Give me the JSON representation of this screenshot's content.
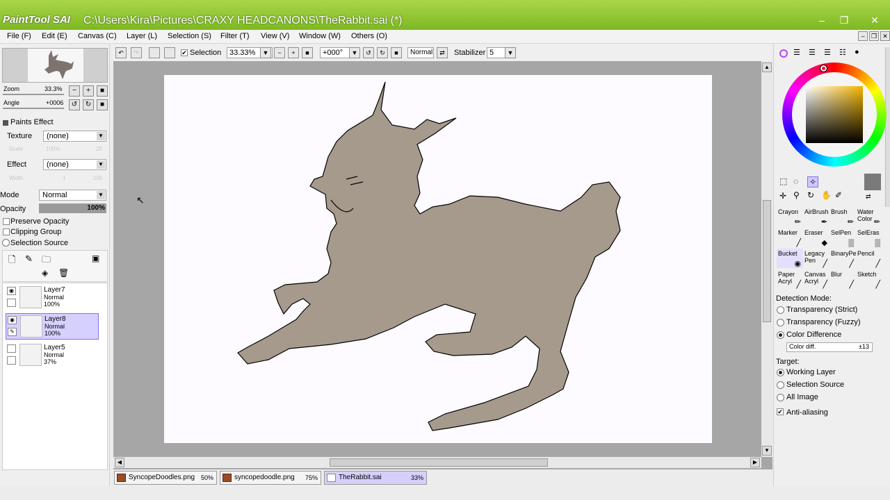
{
  "app": {
    "logo": "PaintTool SAI",
    "title": "C:\\Users\\Kira\\Pictures\\CRAXY HEADCANONS\\TheRabbit.sai (*)",
    "accent": "#8cc63f"
  },
  "menu": [
    "File (F)",
    "Edit (E)",
    "Canvas (C)",
    "Layer (L)",
    "Selection (S)",
    "Filter (T)",
    "View (V)",
    "Window (W)",
    "Others (O)"
  ],
  "navigator": {
    "zoom_label": "Zoom",
    "zoom_value": "33.3%",
    "angle_label": "Angle",
    "angle_value": "+0006"
  },
  "paints_effect": {
    "header": "Paints Effect",
    "texture_label": "Texture",
    "texture_value": "(none)",
    "scale_label": "Scale",
    "scale_value": "100%",
    "scale_num": "20",
    "effect_label": "Effect",
    "effect_value": "(none)",
    "width_label": "Width",
    "width_value": "1",
    "width_num": "100"
  },
  "layer_props": {
    "mode_label": "Mode",
    "mode_value": "Normal",
    "opacity_label": "Opacity",
    "opacity_value": "100%",
    "opacity_fraction": 1.0,
    "preserve_opacity": "Preserve Opacity",
    "clipping_group": "Clipping Group",
    "selection_source": "Selection Source"
  },
  "layers": [
    {
      "name": "Layer7",
      "mode": "Normal",
      "opacity": "100%",
      "selected": false,
      "visible": true
    },
    {
      "name": "Layer8",
      "mode": "Normal",
      "opacity": "100%",
      "selected": true,
      "visible": true
    },
    {
      "name": "Layer5",
      "mode": "Normal",
      "opacity": "37%",
      "selected": false,
      "visible": false
    }
  ],
  "toolbar": {
    "selection_label": "Selection",
    "selection_checked": true,
    "zoom": "33.33%",
    "angle": "+000°",
    "mode": "Normal",
    "stabilizer_label": "Stabilizer",
    "stabilizer_value": "5"
  },
  "files": [
    {
      "name": "SyncopeDoodles.png",
      "zoom": "50%",
      "active": false
    },
    {
      "name": "syncopedoodle.png",
      "zoom": "75%",
      "active": false
    },
    {
      "name": "TheRabbit.sai",
      "zoom": "33%",
      "active": true
    }
  ],
  "tools": [
    {
      "name": "Crayon",
      "icon": "crayon-icon"
    },
    {
      "name": "AirBrush",
      "icon": "airbrush-icon"
    },
    {
      "name": "Brush",
      "icon": "brush-icon"
    },
    {
      "name": "Water Color",
      "icon": "watercolor-icon"
    },
    {
      "name": "Marker",
      "icon": "marker-icon"
    },
    {
      "name": "Eraser",
      "icon": "eraser-icon"
    },
    {
      "name": "SelPen",
      "icon": "selpen-icon"
    },
    {
      "name": "SelEras",
      "icon": "seleras-icon"
    },
    {
      "name": "Bucket",
      "icon": "bucket-icon"
    },
    {
      "name": "Legacy Pen",
      "icon": "pen-icon"
    },
    {
      "name": "BinaryPe",
      "icon": "binarypen-icon"
    },
    {
      "name": "Pencil",
      "icon": "pencil-icon"
    },
    {
      "name": "Paper Acryl",
      "icon": "paper-acrylic-icon"
    },
    {
      "name": "Canvas Acryl",
      "icon": "canvas-acrylic-icon"
    },
    {
      "name": "Blur",
      "icon": "blur-icon"
    },
    {
      "name": "Sketch",
      "icon": "sketch-icon"
    }
  ],
  "bucket_options": {
    "detection_mode_label": "Detection Mode:",
    "modes": [
      "Transparency (Strict)",
      "Transparency (Fuzzy)",
      "Color Difference"
    ],
    "selected_mode": 2,
    "color_diff_label": "Color diff.",
    "color_diff_value": "±13",
    "target_label": "Target:",
    "targets": [
      "Working Layer",
      "Selection Source",
      "All Image"
    ],
    "selected_target": 0,
    "anti_aliasing": "Anti-aliasing",
    "anti_aliasing_checked": true
  },
  "colors": {
    "current": "#7a7a7a",
    "fill": "#a59a8c",
    "paper": "#fdfbff",
    "canvas_bg": "#a6a6a6"
  }
}
